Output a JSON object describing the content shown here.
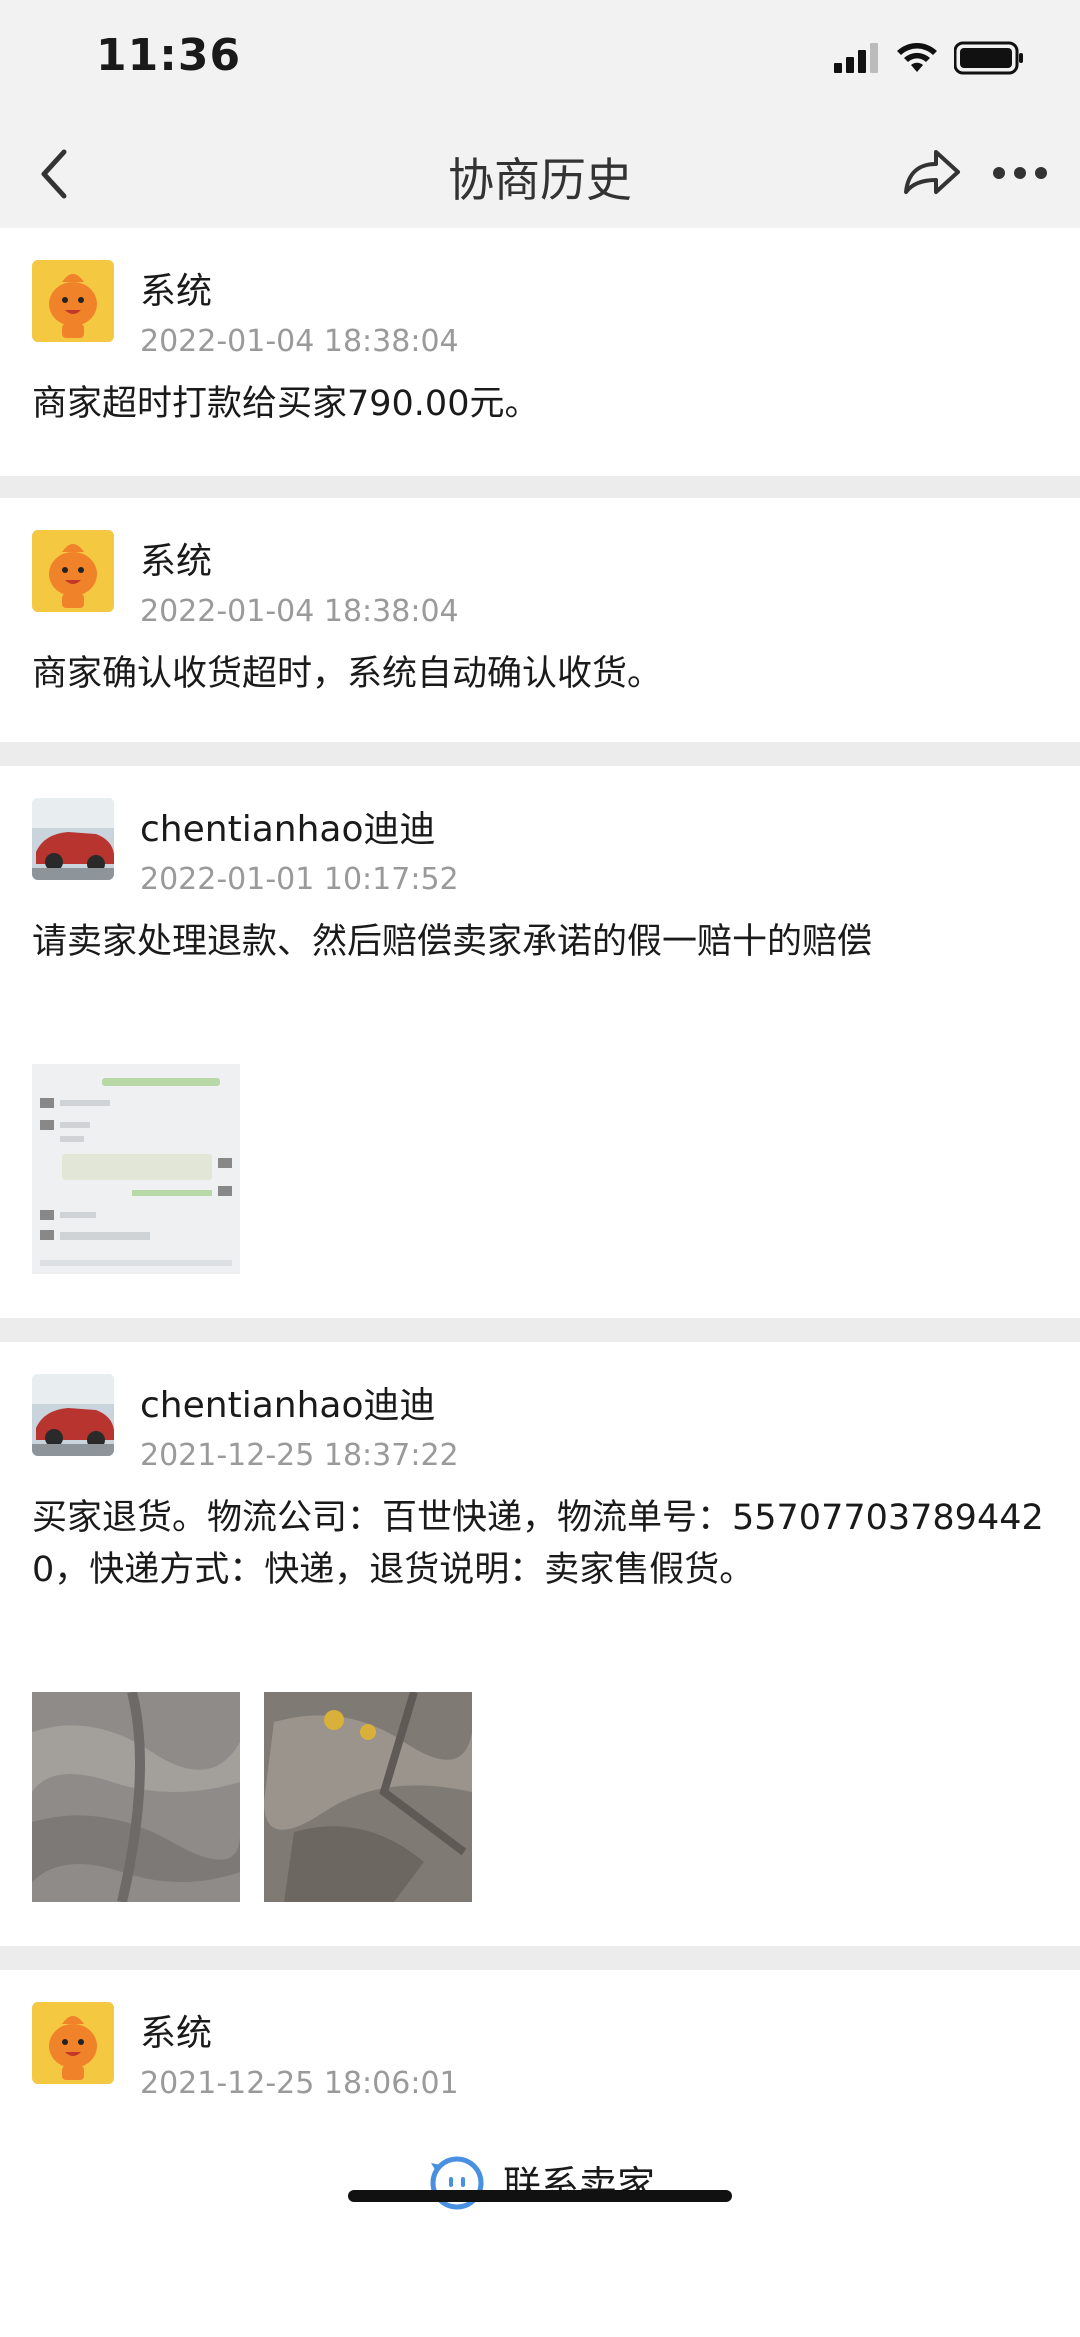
{
  "status_bar": {
    "time": "11:36"
  },
  "nav": {
    "title": "协商历史"
  },
  "entries": [
    {
      "name": "系统",
      "time": "2022-01-04 18:38:04",
      "message": "商家超时打款给买家790.00元。",
      "avatar": "system-mascot"
    },
    {
      "name": "系统",
      "time": "2022-01-04 18:38:04",
      "message": "商家确认收货超时，系统自动确认收货。",
      "avatar": "system-mascot"
    },
    {
      "name": "chentianhao迪迪",
      "time": "2022-01-01 10:17:52",
      "message": "请卖家处理退款、然后赔偿卖家承诺的假一赔十的赔偿",
      "avatar": "user-car-photo",
      "attachments": [
        "chat-screenshot"
      ]
    },
    {
      "name": "chentianhao迪迪",
      "time": "2021-12-25 18:37:22",
      "message": "买家退货。物流公司：百世快递，物流单号：557077037894420，快递方式：快递，退货说明：卖家售假货。",
      "avatar": "user-car-photo",
      "attachments": [
        "fabric-photo",
        "fabric-photo"
      ]
    },
    {
      "name": "系统",
      "time": "2021-12-25 18:06:01",
      "message": "",
      "avatar": "system-mascot"
    }
  ],
  "footer": {
    "contact_label": "联系卖家"
  },
  "colors": {
    "accent": "#4a90e2",
    "mascot": "#f0832a",
    "mascot_bg": "#f5c842"
  }
}
